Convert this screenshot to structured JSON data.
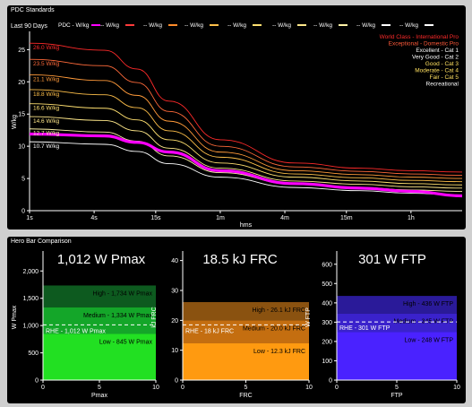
{
  "pdc": {
    "panel_title": "PDC Standards",
    "range_label": "Last 90 Days",
    "legend": [
      {
        "label": "PDC - W/kg",
        "color": "#ff00ff"
      },
      {
        "label": "-- W/kg",
        "color": "#ff3b3b"
      },
      {
        "label": "-- W/kg",
        "color": "#ff8c2a"
      },
      {
        "label": "-- W/kg",
        "color": "#ffc04a"
      },
      {
        "label": "-- W/kg",
        "color": "#ffe070"
      },
      {
        "label": "-- W/kg",
        "color": "#ffe88a"
      },
      {
        "label": "-- W/kg",
        "color": "#fff3a8"
      },
      {
        "label": "-- W/kg",
        "color": "#ffffff"
      },
      {
        "label": "-- W/kg",
        "color": "#ffffff"
      }
    ],
    "categories": [
      {
        "label": "World Class - International Pro",
        "color": "#ff2a2a"
      },
      {
        "label": "Exceptional - Domestic Pro",
        "color": "#ff5a3a"
      },
      {
        "label": "Excellent - Cat 1",
        "color": "#ffffff"
      },
      {
        "label": "Very Good - Cat 2",
        "color": "#ffffff"
      },
      {
        "label": "Good - Cat 3",
        "color": "#ffe060"
      },
      {
        "label": "Moderate - Cat 4",
        "color": "#ffe060"
      },
      {
        "label": "Fair - Cat 5",
        "color": "#ffe060"
      },
      {
        "label": "Recreational",
        "color": "#ffffff"
      }
    ]
  },
  "chart_data": [
    {
      "type": "line",
      "title": "PDC Standards",
      "xlabel": "hms",
      "ylabel": "W/kg",
      "x_ticks": [
        "1s",
        "4s",
        "15s",
        "1m",
        "4m",
        "15m",
        "1h"
      ],
      "x_tick_seconds": [
        1,
        4,
        15,
        60,
        240,
        900,
        3600
      ],
      "ylim": [
        0,
        27
      ],
      "y_ticks": [
        0,
        5,
        10,
        15,
        20,
        25
      ],
      "start_labels": [
        "26.0 W/kg",
        "23.5 W/kg",
        "21.1 W/kg",
        "18.8 W/kg",
        "16.6 W/kg",
        "14.6 W/kg",
        "12.7 W/kg",
        "10.7 W/kg"
      ],
      "x_seconds": [
        1,
        5,
        10,
        20,
        60,
        300,
        1200,
        3600,
        10800
      ],
      "series": [
        {
          "color": "#ff2a2a",
          "values": [
            26.0,
            24.9,
            22.0,
            17.0,
            11.0,
            7.4,
            6.6,
            6.2,
            6.0
          ]
        },
        {
          "color": "#ff6a3a",
          "values": [
            23.5,
            22.5,
            19.9,
            15.4,
            10.0,
            6.8,
            6.1,
            5.7,
            5.5
          ]
        },
        {
          "color": "#ff9a3a",
          "values": [
            21.1,
            20.2,
            17.9,
            13.9,
            9.1,
            6.2,
            5.6,
            5.2,
            5.0
          ]
        },
        {
          "color": "#ffc04a",
          "values": [
            18.8,
            18.0,
            16.0,
            12.4,
            8.3,
            5.7,
            5.1,
            4.7,
            4.5
          ]
        },
        {
          "color": "#ffe070",
          "values": [
            16.6,
            15.9,
            14.1,
            11.0,
            7.4,
            5.2,
            4.6,
            4.2,
            4.0
          ]
        },
        {
          "color": "#ffe88a",
          "values": [
            14.6,
            14.0,
            12.4,
            9.7,
            6.6,
            4.6,
            4.1,
            3.7,
            3.5
          ]
        },
        {
          "color": "#fff3a8",
          "values": [
            12.7,
            12.2,
            10.8,
            8.5,
            5.9,
            4.1,
            3.6,
            3.2,
            3.0
          ]
        },
        {
          "color": "#ffffff",
          "values": [
            10.7,
            10.3,
            9.2,
            7.3,
            5.2,
            3.6,
            3.1,
            2.7,
            2.4
          ]
        },
        {
          "name": "PDC",
          "color": "#ff00ff",
          "values": [
            11.9,
            11.6,
            10.6,
            9.1,
            6.2,
            4.2,
            3.5,
            3.0,
            2.3
          ]
        }
      ]
    },
    {
      "type": "bar",
      "title": "1,012 W Pmax",
      "xlabel": "Pmax",
      "ylabel": "W Pmax",
      "ylim": [
        0,
        2300
      ],
      "y_ticks": [
        0,
        500,
        1000,
        1500,
        2000
      ],
      "y_tick_labels": [
        "0",
        "500",
        "1,000",
        "1,500",
        "2,000"
      ],
      "x_ticks": [
        0,
        5,
        10
      ],
      "bands": [
        {
          "label": "High - 1,734 W Pmax",
          "value": 1734,
          "color": "#0d5a1f"
        },
        {
          "label": "Medium - 1,334 W Pmax",
          "value": 1334,
          "color": "#14a629"
        },
        {
          "label": "Low - 845 W Pmax",
          "value": 845,
          "color": "#22e022"
        }
      ],
      "marker": {
        "label": "RHE - 1,012 W Pmax",
        "value": 1012
      }
    },
    {
      "type": "bar",
      "title": "18.5 kJ FRC",
      "xlabel": "FRC",
      "ylabel": "kJ FRC",
      "ylim": [
        0,
        42
      ],
      "y_ticks": [
        0,
        10,
        20,
        30,
        40
      ],
      "y_tick_labels": [
        "0",
        "10",
        "20",
        "30",
        "40"
      ],
      "x_ticks": [
        0,
        5,
        10
      ],
      "bands": [
        {
          "label": "High - 26.1 kJ FRC",
          "value": 26.1,
          "color": "#8a5210"
        },
        {
          "label": "Medium - 20.0 kJ FRC",
          "value": 20.0,
          "color": "#c46e10"
        },
        {
          "label": "Low - 12.3 kJ FRC",
          "value": 12.3,
          "color": "#ff9a10"
        }
      ],
      "marker": {
        "label": "RHE - 18 kJ FRC",
        "value": 18.5
      }
    },
    {
      "type": "bar",
      "title": "301 W FTP",
      "xlabel": "FTP",
      "ylabel": "W FTP",
      "ylim": [
        0,
        650
      ],
      "y_ticks": [
        0,
        100,
        200,
        300,
        400,
        500,
        600
      ],
      "y_tick_labels": [
        "0",
        "100",
        "200",
        "300",
        "400",
        "500",
        "600"
      ],
      "x_ticks": [
        0,
        5,
        10
      ],
      "bands": [
        {
          "label": "High - 436 W FTP",
          "value": 436,
          "color": "#2a1a99"
        },
        {
          "label": "Medium - 345 W FTP",
          "value": 345,
          "color": "#3a22cc"
        },
        {
          "label": "Low - 248 W FTP",
          "value": 248,
          "color": "#4a22ff"
        }
      ],
      "marker": {
        "label": "RHE - 301 W FTP",
        "value": 301
      }
    }
  ],
  "hero": {
    "panel_title": "Hero Bar Comparison",
    "titles": [
      "1,012 W Pmax",
      "18.5 kJ FRC",
      "301 W FTP"
    ]
  }
}
